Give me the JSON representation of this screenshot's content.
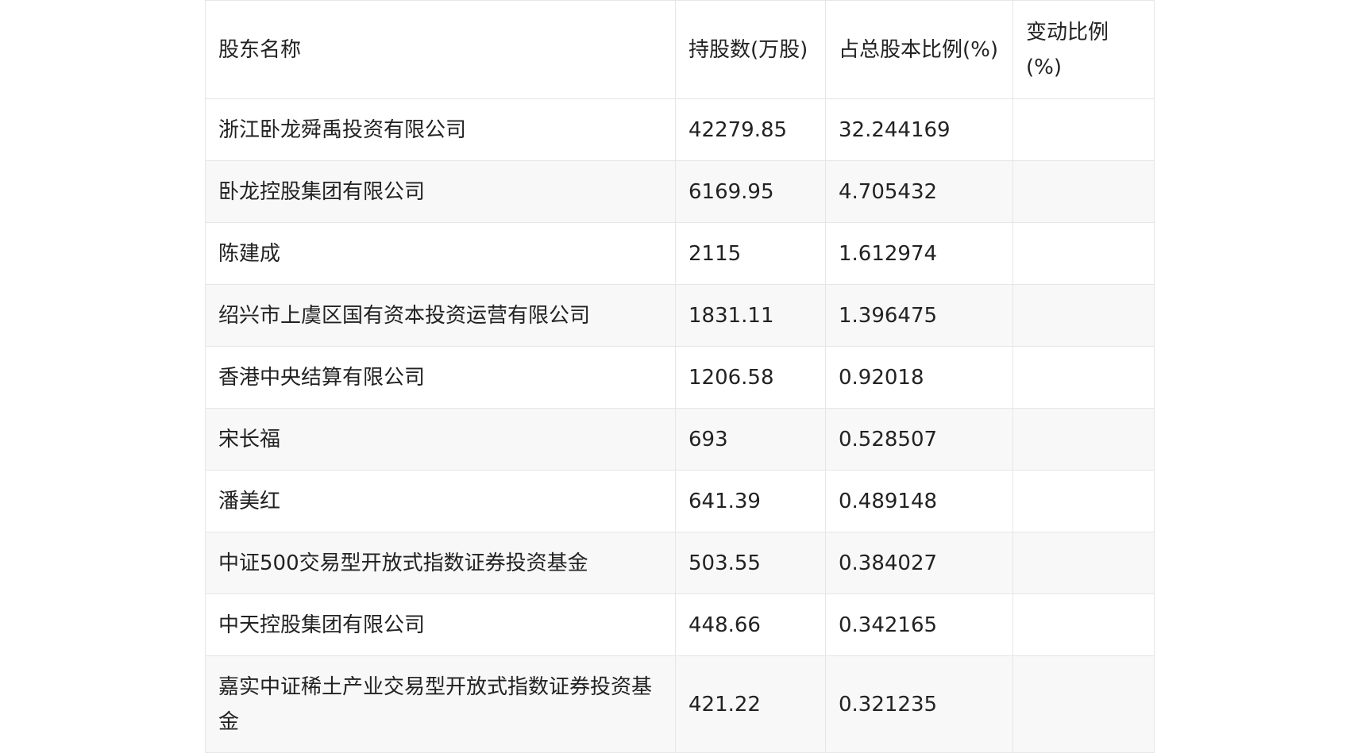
{
  "table": {
    "headers": [
      "股东名称",
      "持股数(万股)",
      "占总股本比例(%)",
      "变动比例(%)"
    ],
    "rows": [
      {
        "name": "浙江卧龙舜禹投资有限公司",
        "shares": "42279.85",
        "ratio": "32.244169",
        "change": ""
      },
      {
        "name": "卧龙控股集团有限公司",
        "shares": "6169.95",
        "ratio": "4.705432",
        "change": ""
      },
      {
        "name": "陈建成",
        "shares": "2115",
        "ratio": "1.612974",
        "change": ""
      },
      {
        "name": "绍兴市上虞区国有资本投资运营有限公司",
        "shares": "1831.11",
        "ratio": "1.396475",
        "change": ""
      },
      {
        "name": "香港中央结算有限公司",
        "shares": "1206.58",
        "ratio": "0.92018",
        "change": ""
      },
      {
        "name": "宋长福",
        "shares": "693",
        "ratio": "0.528507",
        "change": ""
      },
      {
        "name": "潘美红",
        "shares": "641.39",
        "ratio": "0.489148",
        "change": ""
      },
      {
        "name": "中证500交易型开放式指数证券投资基金",
        "shares": "503.55",
        "ratio": "0.384027",
        "change": ""
      },
      {
        "name": "中天控股集团有限公司",
        "shares": "448.66",
        "ratio": "0.342165",
        "change": ""
      },
      {
        "name": "嘉实中证稀土产业交易型开放式指数证券投资基金",
        "shares": "421.22",
        "ratio": "0.321235",
        "change": ""
      }
    ]
  }
}
